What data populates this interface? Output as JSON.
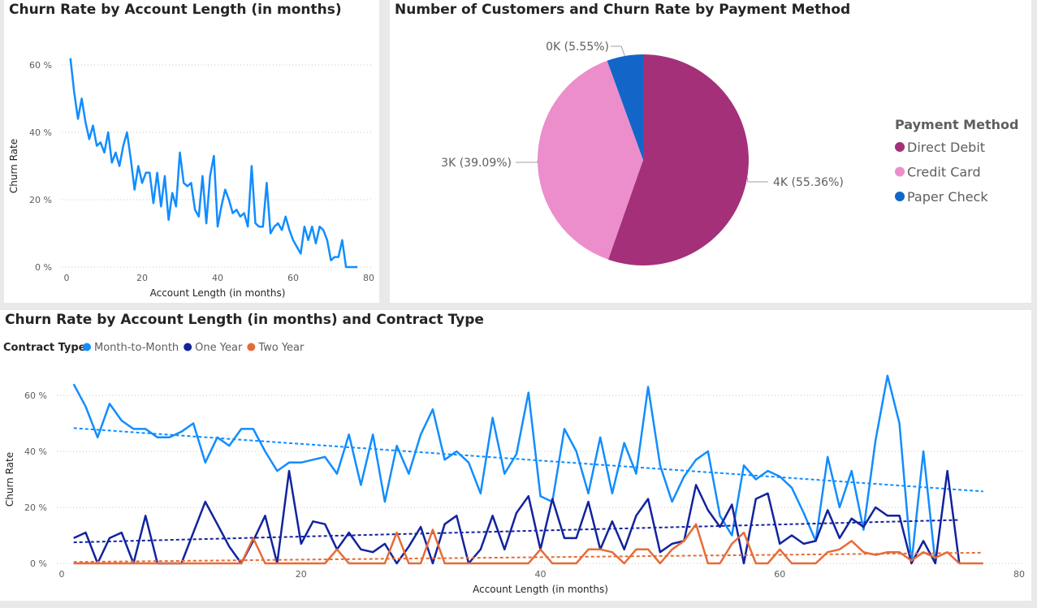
{
  "panels": {
    "top_left_title": "Churn Rate by Account Length (in months)",
    "top_right_title": "Number of Customers and Churn Rate by Payment Method",
    "bottom_title": "Churn Rate by Account Length (in months) and Contract Type"
  },
  "chart_data": [
    {
      "type": "line",
      "title": "Churn Rate by Account Length (in months)",
      "xlabel": "Account Length (in months)",
      "ylabel": "Churn Rate",
      "xlim": [
        0,
        80
      ],
      "ylim": [
        0,
        60
      ],
      "xticks": [
        0,
        20,
        40,
        60,
        80
      ],
      "xtick_labels": [
        "0",
        "20",
        "40",
        "60",
        "80"
      ],
      "yticks": [
        0,
        20,
        40,
        60
      ],
      "ytick_labels": [
        "0 %",
        "20 %",
        "40 %",
        "60 %"
      ],
      "grid": "horizontal dotted",
      "color": "#118dff",
      "series": [
        {
          "x": [
            1,
            2,
            3,
            4,
            5,
            6,
            7,
            8,
            9,
            10,
            11,
            12,
            13,
            14,
            15,
            16,
            17,
            18,
            19,
            20,
            21,
            22,
            23,
            24,
            25,
            26,
            27,
            28,
            29,
            30,
            31,
            32,
            33,
            34,
            35,
            36,
            37,
            38,
            39,
            40,
            41,
            42,
            43,
            44,
            45,
            46,
            47,
            48,
            49,
            50,
            51,
            52,
            53,
            54,
            55,
            56,
            57,
            58,
            59,
            60,
            61,
            62,
            63,
            64,
            65,
            66,
            67,
            68,
            69,
            70,
            71,
            72,
            73,
            74,
            75,
            76,
            77
          ],
          "values": [
            62,
            52,
            44,
            50,
            43,
            38,
            42,
            36,
            37,
            34,
            40,
            31,
            34,
            30,
            36,
            40,
            32,
            23,
            30,
            25,
            28,
            28,
            19,
            28,
            18,
            27,
            14,
            22,
            18,
            34,
            25,
            24,
            25,
            17,
            15,
            27,
            13,
            27,
            33,
            12,
            18,
            23,
            20,
            16,
            17,
            15,
            16,
            12,
            30,
            13,
            12,
            12,
            25,
            10,
            12,
            13,
            11,
            15,
            11,
            8,
            6,
            4,
            12,
            8,
            12,
            7,
            12,
            11,
            8,
            2,
            3,
            3,
            8,
            0,
            0,
            0,
            0
          ]
        }
      ]
    },
    {
      "type": "pie",
      "title": "Number of Customers and Churn Rate by Payment Method",
      "legend_title": "Payment Method",
      "legend_position": "right",
      "slices": [
        {
          "name": "Direct Debit",
          "percent": 55.36,
          "label": "4K (55.36%)",
          "color": "#a4307a"
        },
        {
          "name": "Credit Card",
          "percent": 39.09,
          "label": "3K (39.09%)",
          "color": "#ec8ecb"
        },
        {
          "name": "Paper Check",
          "percent": 5.55,
          "label": "0K (5.55%)",
          "color": "#1366c7"
        }
      ]
    },
    {
      "type": "line",
      "title": "Churn Rate by Account Length (in months) and Contract Type",
      "legend_title": "Contract Type",
      "legend_position": "top-left",
      "xlabel": "Account Length (in months)",
      "ylabel": "Churn Rate",
      "xlim": [
        0,
        80
      ],
      "ylim": [
        0,
        60
      ],
      "xticks": [
        0,
        20,
        40,
        60,
        80
      ],
      "xtick_labels": [
        "0",
        "20",
        "40",
        "60",
        "80"
      ],
      "yticks": [
        0,
        20,
        40,
        60
      ],
      "ytick_labels": [
        "0 %",
        "20 %",
        "40 %",
        "60 %"
      ],
      "grid": "horizontal dotted",
      "trendlines": true,
      "series": [
        {
          "name": "Month-to-Month",
          "color": "#118dff",
          "x": [
            1,
            2,
            3,
            4,
            5,
            6,
            7,
            8,
            9,
            10,
            11,
            12,
            13,
            14,
            15,
            16,
            17,
            18,
            19,
            20,
            21,
            22,
            23,
            24,
            25,
            26,
            27,
            28,
            29,
            30,
            31,
            32,
            33,
            34,
            35,
            36,
            37,
            38,
            39,
            40,
            41,
            42,
            43,
            44,
            45,
            46,
            47,
            48,
            49,
            50,
            51,
            52,
            53,
            54,
            55,
            56,
            57,
            58,
            59,
            60,
            61,
            62,
            63,
            64,
            65,
            66,
            67,
            68,
            69,
            70,
            71,
            72,
            73
          ],
          "values": [
            64,
            56,
            45,
            57,
            51,
            48,
            48,
            45,
            45,
            47,
            50,
            36,
            45,
            42,
            48,
            48,
            40,
            33,
            36,
            36,
            37,
            38,
            32,
            46,
            28,
            46,
            22,
            42,
            32,
            46,
            55,
            37,
            40,
            36,
            25,
            52,
            32,
            39,
            61,
            24,
            22,
            48,
            40,
            25,
            45,
            25,
            43,
            32,
            63,
            35,
            22,
            31,
            37,
            40,
            17,
            10,
            35,
            30,
            33,
            31,
            27,
            18,
            8,
            38,
            20,
            33,
            12,
            44,
            67,
            50,
            0,
            40,
            0
          ],
          "trend": [
            48.3,
            25.7
          ],
          "trend_x": [
            1,
            77
          ]
        },
        {
          "name": "One Year",
          "color": "#12239e",
          "x": [
            1,
            2,
            3,
            4,
            5,
            6,
            7,
            8,
            9,
            10,
            11,
            12,
            13,
            14,
            15,
            16,
            17,
            18,
            19,
            20,
            21,
            22,
            23,
            24,
            25,
            26,
            27,
            28,
            29,
            30,
            31,
            32,
            33,
            34,
            35,
            36,
            37,
            38,
            39,
            40,
            41,
            42,
            43,
            44,
            45,
            46,
            47,
            48,
            49,
            50,
            51,
            52,
            53,
            54,
            55,
            56,
            57,
            58,
            59,
            60,
            61,
            62,
            63,
            64,
            65,
            66,
            67,
            68,
            69,
            70,
            71,
            72,
            73,
            74,
            75
          ],
          "values": [
            9,
            11,
            0,
            9,
            11,
            0,
            17,
            0,
            0,
            0,
            11,
            22,
            14,
            6,
            0,
            8,
            17,
            0,
            33,
            7,
            15,
            14,
            5,
            11,
            5,
            4,
            7,
            0,
            6,
            13,
            0,
            14,
            17,
            0,
            5,
            17,
            5,
            18,
            24,
            5,
            23,
            9,
            9,
            22,
            5,
            15,
            5,
            17,
            23,
            4,
            7,
            8,
            28,
            19,
            13,
            21,
            0,
            23,
            25,
            7,
            10,
            7,
            8,
            19,
            9,
            16,
            13,
            20,
            17,
            17,
            0,
            8,
            0,
            33,
            0
          ],
          "trend": [
            7.5,
            15.5
          ],
          "trend_x": [
            1,
            75
          ]
        },
        {
          "name": "Two Year",
          "color": "#e66c37",
          "x": [
            1,
            2,
            3,
            4,
            5,
            6,
            7,
            8,
            9,
            10,
            11,
            12,
            13,
            14,
            15,
            16,
            17,
            18,
            19,
            20,
            21,
            22,
            23,
            24,
            25,
            26,
            27,
            28,
            29,
            30,
            31,
            32,
            33,
            34,
            35,
            36,
            37,
            38,
            39,
            40,
            41,
            42,
            43,
            44,
            45,
            46,
            47,
            48,
            49,
            50,
            51,
            52,
            53,
            54,
            55,
            56,
            57,
            58,
            59,
            60,
            61,
            62,
            63,
            64,
            65,
            66,
            67,
            68,
            69,
            70,
            71,
            72,
            73,
            74,
            75,
            76,
            77
          ],
          "values": [
            0,
            0,
            0,
            0,
            0,
            0,
            0,
            0,
            0,
            0,
            0,
            0,
            0,
            0,
            0,
            9,
            0,
            0,
            0,
            0,
            0,
            0,
            5,
            0,
            0,
            0,
            0,
            11,
            0,
            0,
            12,
            0,
            0,
            0,
            0,
            0,
            0,
            0,
            0,
            5,
            0,
            0,
            0,
            5,
            5,
            4,
            0,
            5,
            5,
            0,
            5,
            8,
            14,
            0,
            0,
            7,
            11,
            0,
            0,
            5,
            0,
            0,
            0,
            4,
            5,
            8,
            4,
            3,
            4,
            4,
            1,
            4,
            2,
            4,
            0,
            0,
            0
          ],
          "trend": [
            0.5,
            3.8
          ],
          "trend_x": [
            1,
            77
          ]
        }
      ]
    }
  ]
}
